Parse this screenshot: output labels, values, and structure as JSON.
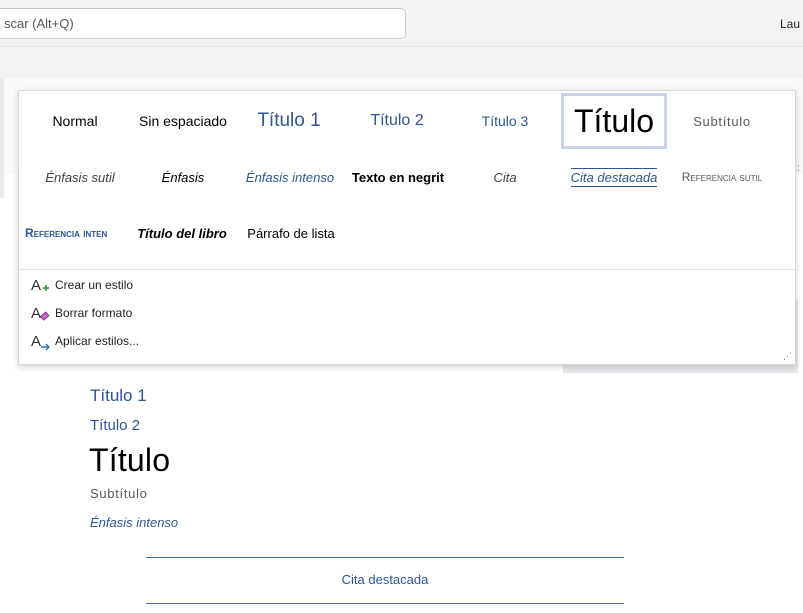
{
  "search": {
    "placeholder": "scar (Alt+Q)"
  },
  "user": {
    "name": "Lau"
  },
  "ribbon": {
    "tick": ":"
  },
  "styles_gallery": {
    "selected": "Título",
    "rows": [
      [
        {
          "label": "Normal"
        },
        {
          "label": "Sin espaciado"
        },
        {
          "label": "Título 1"
        },
        {
          "label": "Título 2"
        },
        {
          "label": "Título 3"
        },
        {
          "label": "Título"
        },
        {
          "label": "Subtítulo"
        }
      ],
      [
        {
          "label": "Énfasis sutil"
        },
        {
          "label": "Énfasis"
        },
        {
          "label": "Énfasis intenso"
        },
        {
          "label": "Texto en negrit"
        },
        {
          "label": "Cita"
        },
        {
          "label": "Cita destacada"
        },
        {
          "label": "Referencia sutil"
        }
      ],
      [
        {
          "label": "Referencia inten"
        },
        {
          "label": "Título del libro"
        },
        {
          "label": "Párrafo de lista"
        }
      ]
    ],
    "commands": [
      {
        "label": "Crear un estilo",
        "icon": "create-style-icon"
      },
      {
        "label": "Borrar formato",
        "icon": "clear-formatting-icon"
      },
      {
        "label": "Aplicar estilos...",
        "icon": "apply-styles-icon"
      }
    ],
    "grip": "⋰"
  },
  "document": {
    "heading1": "Título 1",
    "heading2": "Título 2",
    "title": "Título",
    "subtitle": "Subtítulo",
    "intense_emphasis": "Énfasis intenso",
    "intense_quote": "Cita destacada"
  },
  "colors": {
    "accent_blue": "#2f5597",
    "heading_blue": "#2e74b5",
    "selection_border": "#c7d4ea",
    "quote_rule": "#4a72b0"
  }
}
